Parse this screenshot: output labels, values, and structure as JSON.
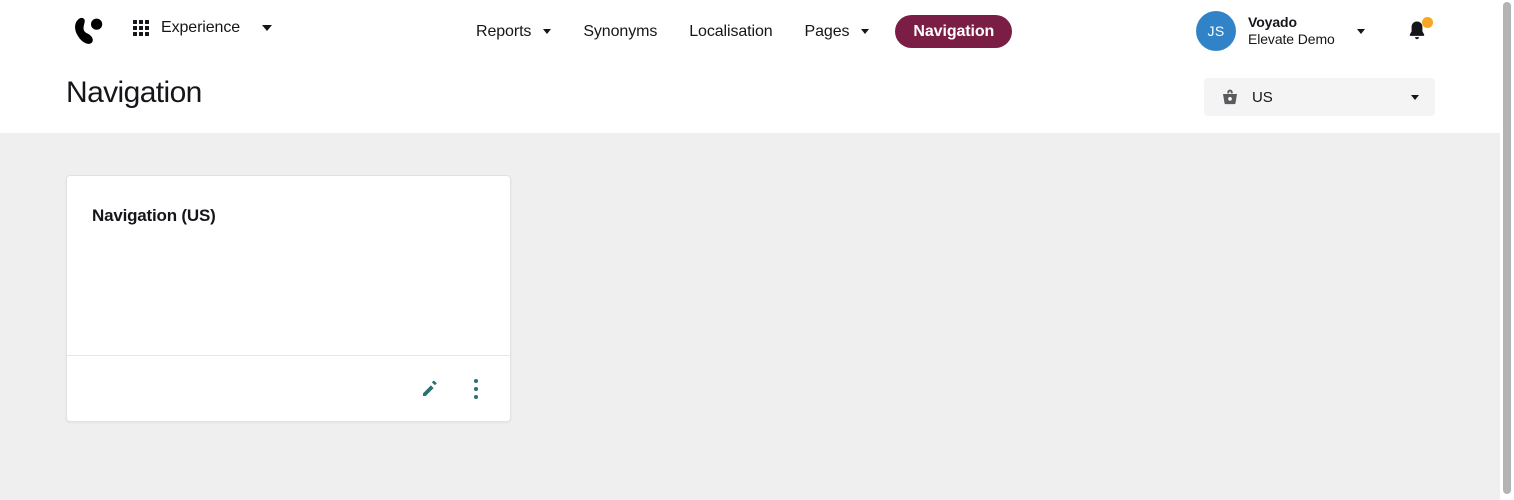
{
  "app": {
    "brand_logo": "voyado-logo",
    "accent_active": "#7b1e45",
    "accent_icon": "#2a6f72",
    "avatar_color": "#3183c8",
    "notification_color": "#f5a623"
  },
  "topnav": {
    "app_switcher": {
      "icon": "grid-icon",
      "label": "Experience",
      "caret": "chevron-down-icon"
    },
    "items": [
      {
        "label": "Reports",
        "has_caret": true,
        "active": false
      },
      {
        "label": "Synonyms",
        "has_caret": false,
        "active": false
      },
      {
        "label": "Localisation",
        "has_caret": false,
        "active": false
      },
      {
        "label": "Pages",
        "has_caret": true,
        "active": false
      }
    ],
    "active_item": {
      "label": "Navigation",
      "active": true
    },
    "account": {
      "initials": "JS",
      "org": "Voyado",
      "environment": "Elevate Demo",
      "caret": "chevron-down-icon"
    },
    "notifications": {
      "icon": "bell-icon",
      "has_unread": true
    }
  },
  "page": {
    "title": "Navigation",
    "market_selector": {
      "icon": "basket-icon",
      "value": "US",
      "caret": "chevron-down-icon"
    }
  },
  "content": {
    "cards": [
      {
        "title": "Navigation (US)",
        "actions": {
          "edit": "edit-pencil-icon",
          "more": "more-vertical-icon"
        }
      }
    ]
  }
}
